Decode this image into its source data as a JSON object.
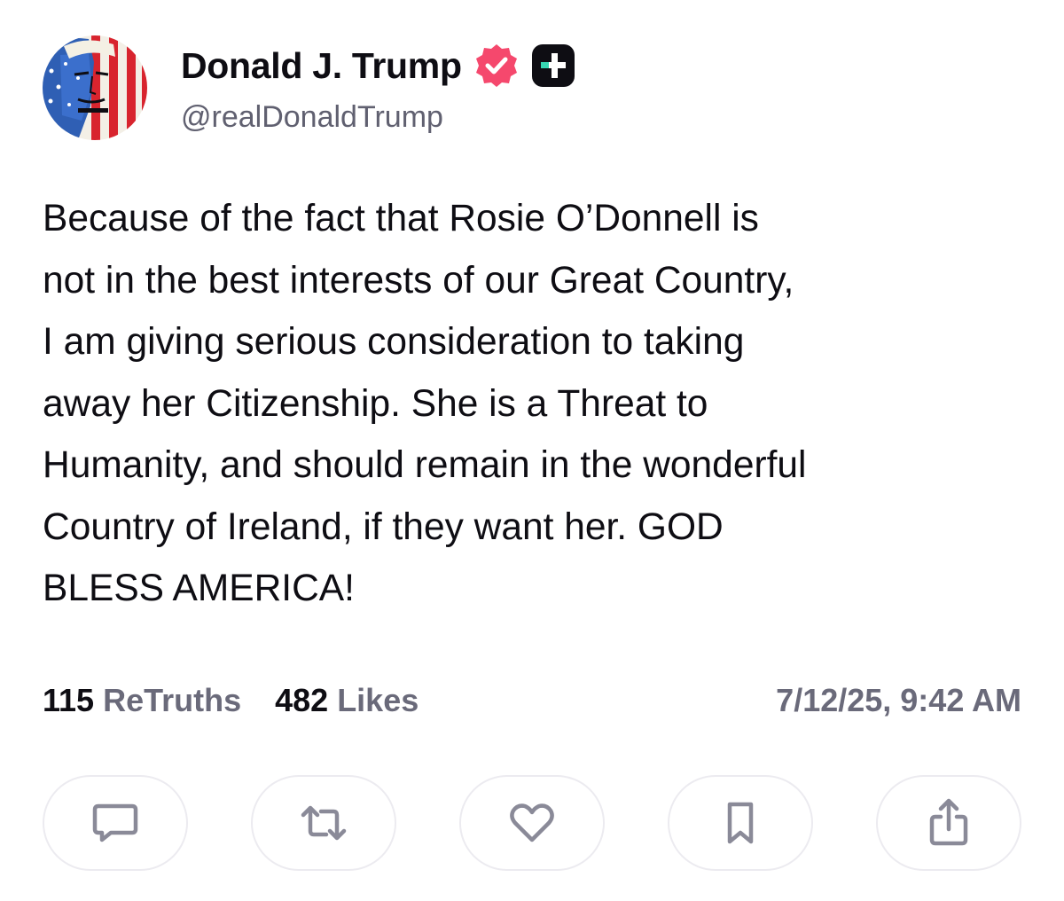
{
  "header": {
    "display_name": "Donald J. Trump",
    "handle": "@realDonaldTrump",
    "verified_icon": "verified-badge-icon",
    "plus_badge_icon": "truth-plus-icon"
  },
  "post": {
    "lines": [
      "Because of the fact that Rosie O’Donnell is",
      "not in the best interests of our Great Country,",
      "I am giving serious consideration to taking",
      "away her Citizenship. She is a Threat to",
      "Humanity, and should remain in the wonderful",
      "Country of Ireland, if they want her. GOD",
      "BLESS AMERICA!"
    ]
  },
  "stats": {
    "retruths_count": "115",
    "retruths_label": "ReTruths",
    "likes_count": "482",
    "likes_label": "Likes",
    "timestamp": "7/12/25, 9:42 AM"
  },
  "actions": [
    {
      "icon": "comment-icon"
    },
    {
      "icon": "retruth-icon"
    },
    {
      "icon": "heart-icon"
    },
    {
      "icon": "bookmark-icon"
    },
    {
      "icon": "share-icon"
    }
  ],
  "colors": {
    "text": "#0e0d13",
    "secondary_text": "#6a6a7a",
    "verified_badge": "#f5486d",
    "icon_stroke": "#8a8a98",
    "button_border": "#ecebf0"
  }
}
